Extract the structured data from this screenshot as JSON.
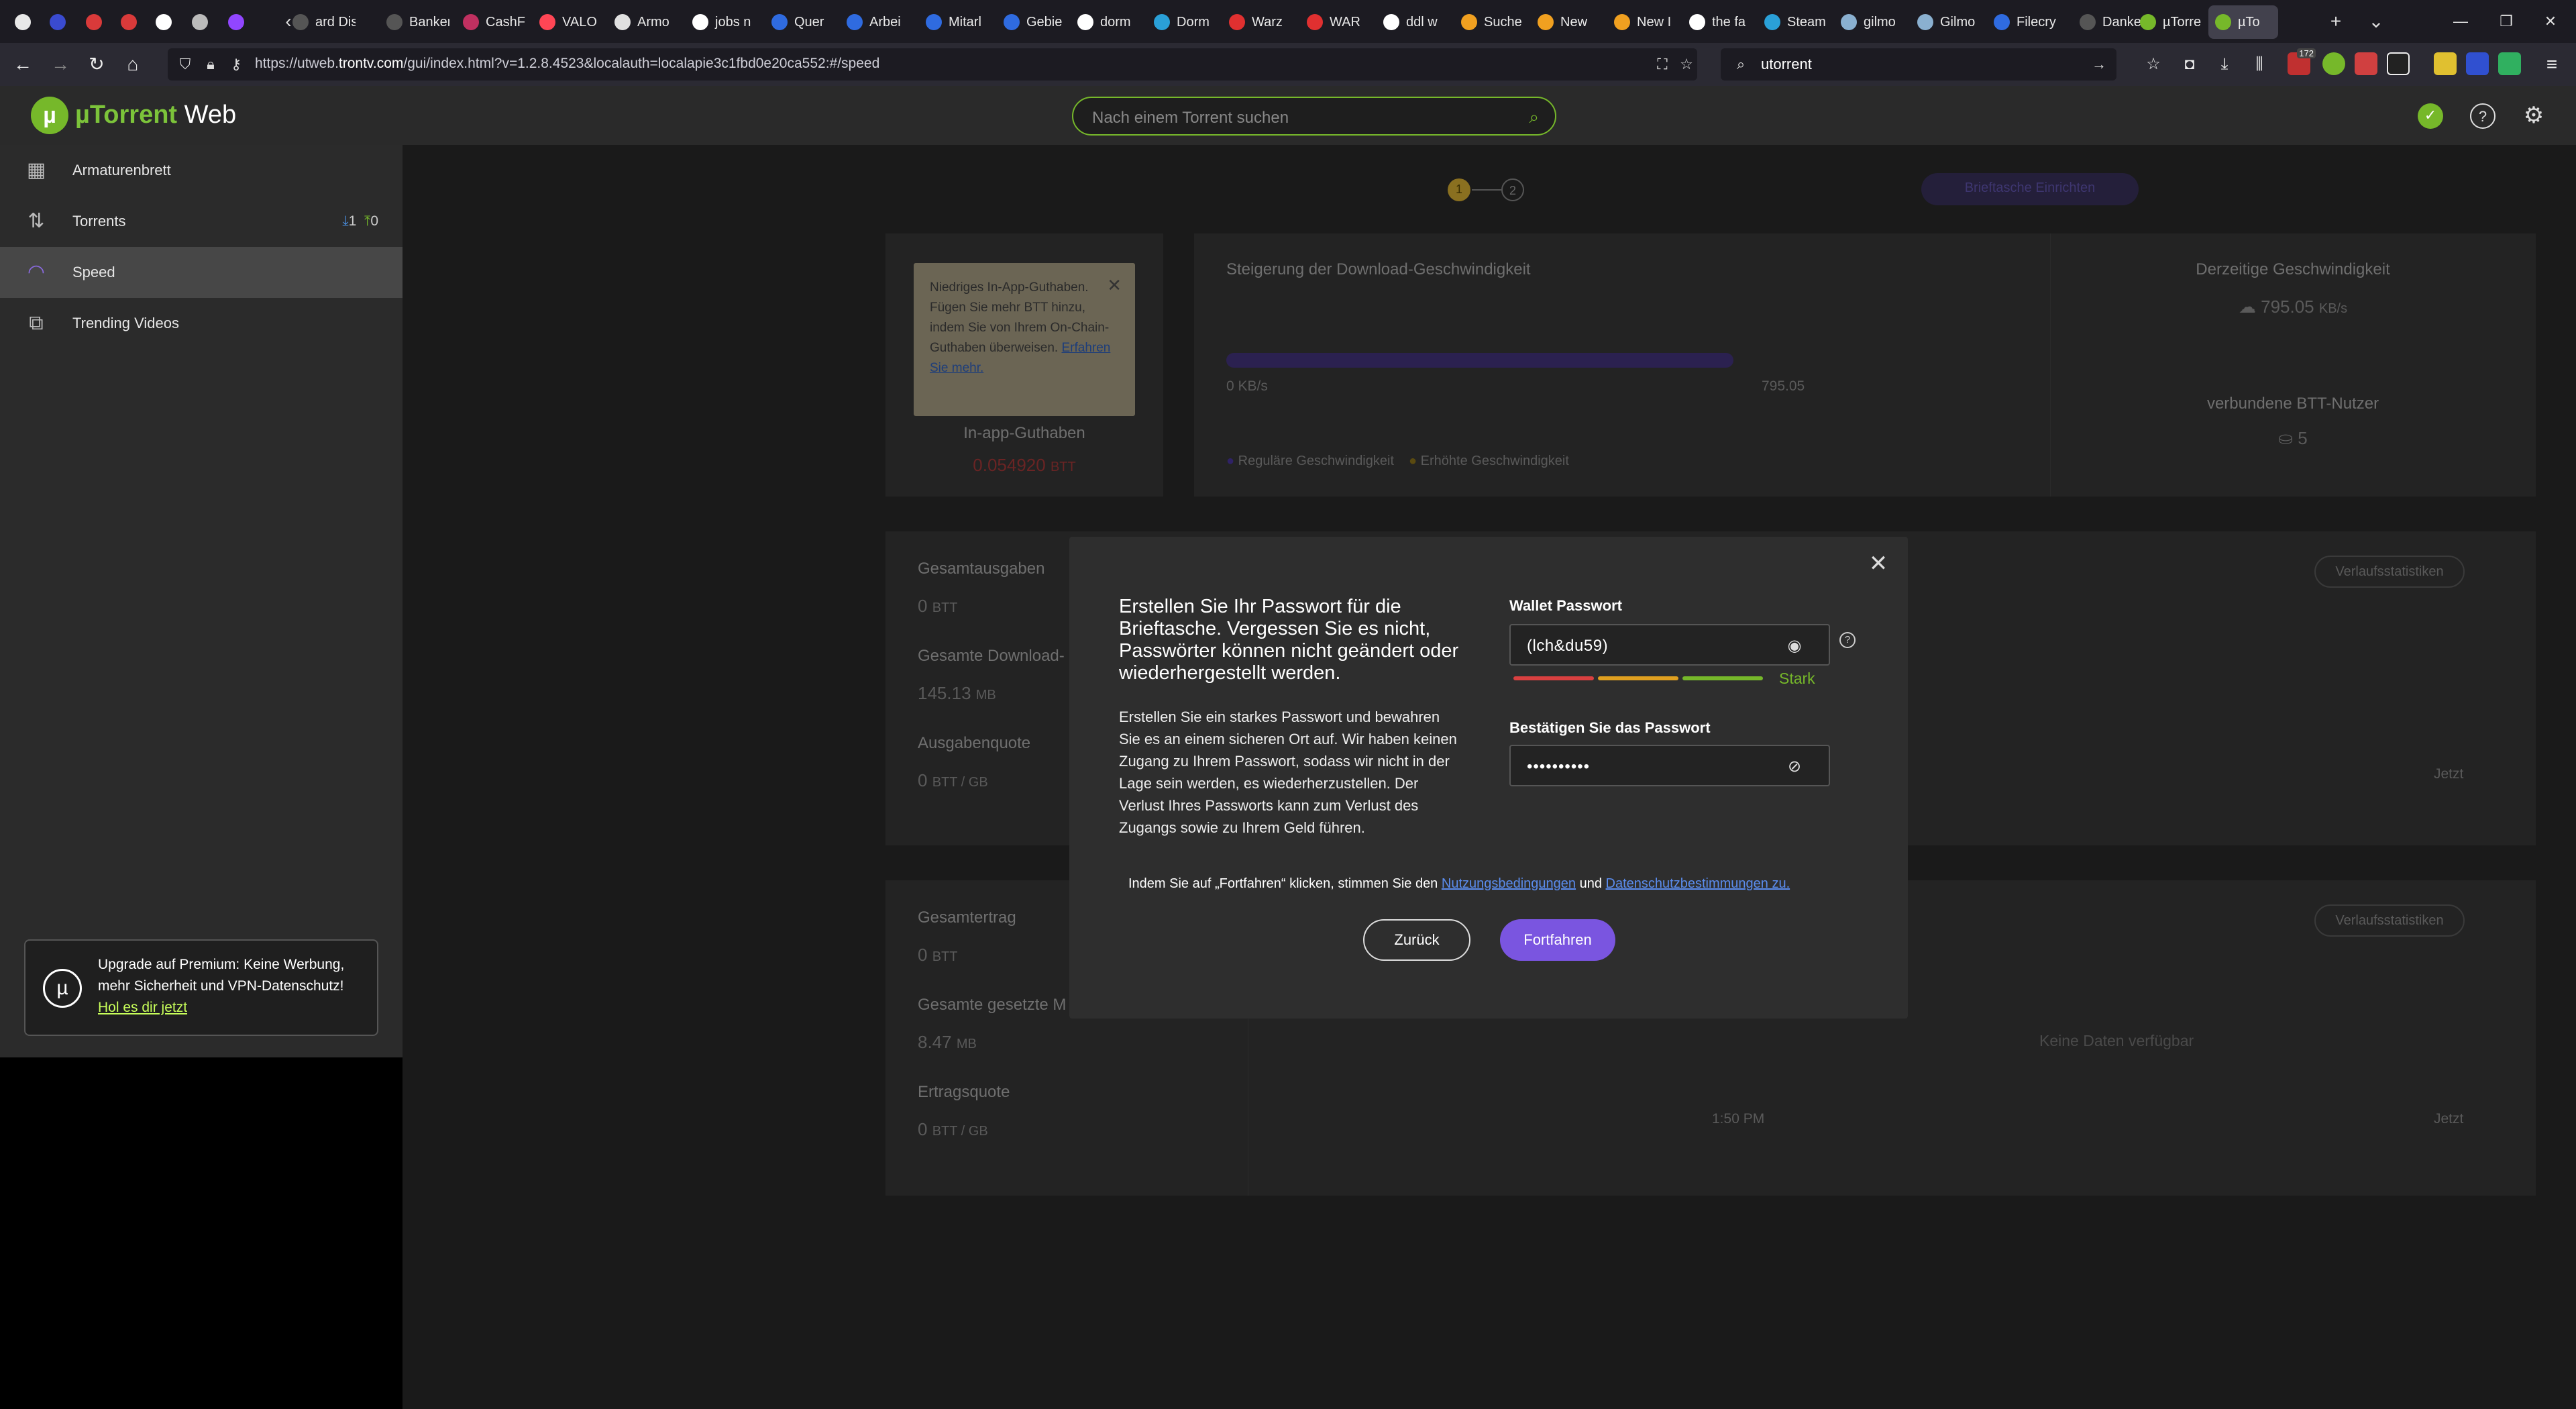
{
  "browser": {
    "tabs": [
      {
        "label": "",
        "color": "#e8e8e8"
      },
      {
        "label": "",
        "color": "#3a4bd0"
      },
      {
        "label": "",
        "color": "#d93a3a"
      },
      {
        "label": "",
        "color": "#d93a3a"
      },
      {
        "label": "",
        "color": "#ffffff"
      },
      {
        "label": "",
        "color": "#bbbbbb"
      },
      {
        "label": "",
        "color": "#9146ff"
      },
      {
        "label": "ard Disk",
        "color": "#555555"
      },
      {
        "label": "Banken in",
        "color": "#555555"
      },
      {
        "label": "CashF",
        "color": "#c03060"
      },
      {
        "label": "VALO",
        "color": "#ff4655"
      },
      {
        "label": "Armo",
        "color": "#e0e0e0"
      },
      {
        "label": "jobs n",
        "color": "#ffffff"
      },
      {
        "label": "Quer",
        "color": "#2f6be0"
      },
      {
        "label": "Arbei",
        "color": "#2f6be0"
      },
      {
        "label": "Mitarl",
        "color": "#2f6be0"
      },
      {
        "label": "Gebie",
        "color": "#2f6be0"
      },
      {
        "label": "dorm",
        "color": "#ffffff"
      },
      {
        "label": "Dorm",
        "color": "#2aa0d8"
      },
      {
        "label": "Warz",
        "color": "#e03030"
      },
      {
        "label": "WAR",
        "color": "#e03030"
      },
      {
        "label": "ddl w",
        "color": "#ffffff"
      },
      {
        "label": "Suche",
        "color": "#f0a020"
      },
      {
        "label": "New",
        "color": "#f0a020"
      },
      {
        "label": "New I",
        "color": "#f0a020"
      },
      {
        "label": "the fa",
        "color": "#ffffff"
      },
      {
        "label": "Steam",
        "color": "#2aa0d8"
      },
      {
        "label": "gilmo",
        "color": "#8ab0d0"
      },
      {
        "label": "Gilmo",
        "color": "#8ab0d0"
      },
      {
        "label": "Filecry",
        "color": "#2f6be0"
      },
      {
        "label": "Danke",
        "color": "#555555"
      },
      {
        "label": "µTorre",
        "color": "#76b82a"
      },
      {
        "label": "µTo",
        "color": "#76b82a"
      }
    ],
    "new_tab": "+",
    "tab_list": "⌄",
    "win_min": "—",
    "win_max": "❐",
    "win_close": "✕",
    "url_prefix": "https://utweb.",
    "url_domain": "trontv.com",
    "url_suffix": "/gui/index.html?v=1.2.8.4523&localauth=localapie3c1fbd0e20ca552:#/speed",
    "search_value": "utorrent",
    "badge_count": "172"
  },
  "app": {
    "logo_letter": "µ",
    "brand_mu": "µTorrent",
    "brand_rest": " Web",
    "search_placeholder": "Nach einem Torrent suchen",
    "accent": "#76b82a"
  },
  "sidebar": {
    "items": [
      {
        "label": "Armaturenbrett",
        "icon": "dashboard-icon"
      },
      {
        "label": "Torrents",
        "icon": "transfer-icon",
        "down": "1",
        "up": "0"
      },
      {
        "label": "Speed",
        "icon": "speed-icon"
      },
      {
        "label": "Trending Videos",
        "icon": "video-icon"
      }
    ],
    "premium": {
      "text": "Upgrade auf Premium: Keine Werbung, mehr Sicherheit und VPN-Datenschutz!",
      "link": "Hol es dir jetzt"
    }
  },
  "speed_page": {
    "step1": "1",
    "step2": "2",
    "wallet_btn": "Brieftasche Einrichten",
    "tooltip_text": "Niedriges In-App-Guthaben. Fügen Sie mehr BTT hinzu, indem Sie von Ihrem On-Chain-Guthaben überweisen.",
    "tooltip_link": "Erfahren Sie mehr.",
    "inapp_label": "In-app-Guthaben",
    "inapp_value": "0.054920",
    "inapp_unit": "BTT",
    "boost_title": "Steigerung der Download-Geschwindigkeit",
    "boost_min": "0 KB/s",
    "boost_max": "795.05",
    "legend_regular": "Reguläre Geschwindigkeit",
    "legend_boost": "Erhöhte Geschwindigkeit",
    "current_title": "Derzeitige Geschwindigkeit",
    "current_value": "795.05",
    "current_unit": "KB/s",
    "peers_title": "verbundene BTT-Nutzer",
    "peers_value": "5",
    "spend": {
      "total_label": "Gesamtausgaben",
      "total_value": "0",
      "total_unit": "BTT",
      "dl_label": "Gesamte Download-",
      "dl_value": "145.13",
      "dl_unit": "MB",
      "rate_label": "Ausgabenquote",
      "rate_value": "0",
      "rate_unit": "BTT / GB",
      "history": "Verlaufsstatistiken",
      "now": "Jetzt"
    },
    "earn": {
      "total_label": "Gesamtertrag",
      "total_value": "0",
      "total_unit": "BTT",
      "seed_label": "Gesamte gesetzte M",
      "seed_value": "8.47",
      "seed_unit": "MB",
      "rate_label": "Ertragsquote",
      "rate_value": "0",
      "rate_unit": "BTT / GB",
      "history": "Verlaufsstatistiken",
      "no_data": "Keine Daten verfügbar",
      "time_start": "1:50 PM",
      "now": "Jetzt"
    }
  },
  "modal": {
    "close": "✕",
    "title": "Erstellen Sie Ihr Passwort für die Brieftasche. Vergessen Sie es nicht, Passwörter können nicht geändert oder wiederhergestellt werden.",
    "body": "Erstellen Sie ein starkes Passwort und bewahren Sie es an einem sicheren Ort auf. Wir haben keinen Zugang zu Ihrem Passwort, sodass wir nicht in der Lage sein werden, es wiederherzustellen. Der Verlust Ihres Passworts kann zum Verlust des Zugangs sowie zu Ihrem Geld führen.",
    "pw_label": "Wallet Passwort",
    "pw_value": "(lch&du59)",
    "pw_strength": "Stark",
    "pw_strength_level": 1.0,
    "confirm_label": "Bestätigen Sie das Passwort",
    "confirm_value": "••••••••••",
    "help": "?",
    "terms_pre": "Indem Sie auf „Fortfahren“ klicken, stimmen Sie den",
    "terms_link1": "Nutzungsbedingungen",
    "terms_mid": "und",
    "terms_link2": "Datenschutzbestimmungen zu.",
    "back_label": "Zurück",
    "continue_label": "Fortfahren",
    "primary_color": "#7a55e0"
  }
}
